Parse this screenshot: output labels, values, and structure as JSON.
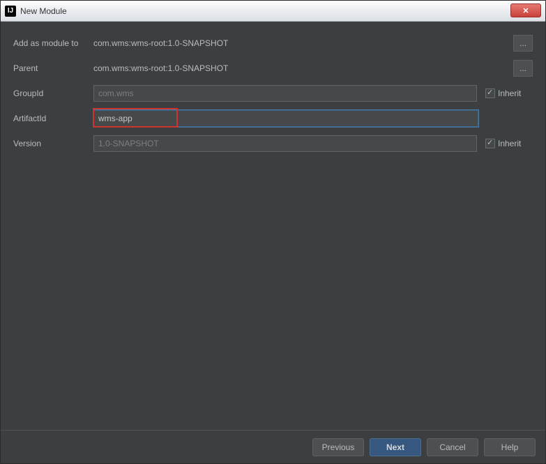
{
  "window": {
    "title": "New Module",
    "app_icon_text": "IJ",
    "close_glyph": "✕"
  },
  "form": {
    "add_module": {
      "label": "Add as module to",
      "value": "com.wms:wms-root:1.0-SNAPSHOT",
      "browse": "..."
    },
    "parent": {
      "label": "Parent",
      "value": "com.wms:wms-root:1.0-SNAPSHOT",
      "browse": "..."
    },
    "group_id": {
      "label": "GroupId",
      "value": "com.wms",
      "inherit_label": "Inherit",
      "inherit_checked": true
    },
    "artifact_id": {
      "label": "ArtifactId",
      "value": "wms-app"
    },
    "version": {
      "label": "Version",
      "value": "1.0-SNAPSHOT",
      "inherit_label": "Inherit",
      "inherit_checked": true
    }
  },
  "footer": {
    "previous": "Previous",
    "next": "Next",
    "cancel": "Cancel",
    "help": "Help"
  }
}
